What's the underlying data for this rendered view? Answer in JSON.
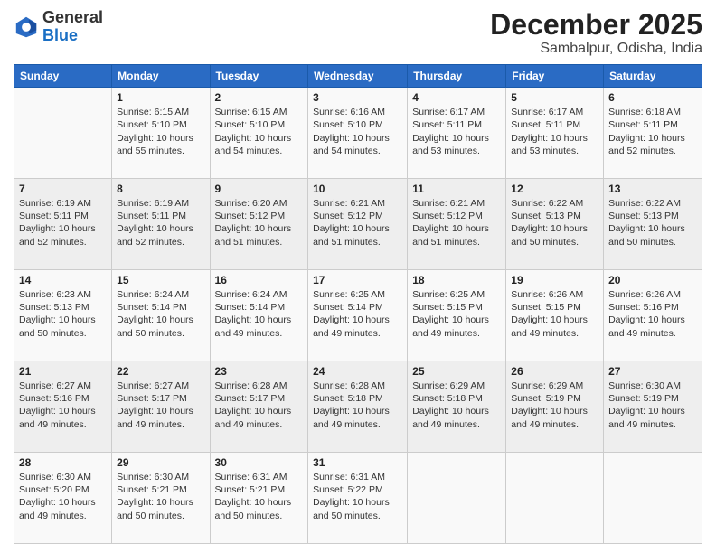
{
  "logo": {
    "general": "General",
    "blue": "Blue"
  },
  "header": {
    "month": "December 2025",
    "location": "Sambalpur, Odisha, India"
  },
  "days_of_week": [
    "Sunday",
    "Monday",
    "Tuesday",
    "Wednesday",
    "Thursday",
    "Friday",
    "Saturday"
  ],
  "weeks": [
    [
      {
        "day": "",
        "info": ""
      },
      {
        "day": "1",
        "info": "Sunrise: 6:15 AM\nSunset: 5:10 PM\nDaylight: 10 hours\nand 55 minutes."
      },
      {
        "day": "2",
        "info": "Sunrise: 6:15 AM\nSunset: 5:10 PM\nDaylight: 10 hours\nand 54 minutes."
      },
      {
        "day": "3",
        "info": "Sunrise: 6:16 AM\nSunset: 5:10 PM\nDaylight: 10 hours\nand 54 minutes."
      },
      {
        "day": "4",
        "info": "Sunrise: 6:17 AM\nSunset: 5:11 PM\nDaylight: 10 hours\nand 53 minutes."
      },
      {
        "day": "5",
        "info": "Sunrise: 6:17 AM\nSunset: 5:11 PM\nDaylight: 10 hours\nand 53 minutes."
      },
      {
        "day": "6",
        "info": "Sunrise: 6:18 AM\nSunset: 5:11 PM\nDaylight: 10 hours\nand 52 minutes."
      }
    ],
    [
      {
        "day": "7",
        "info": "Sunrise: 6:19 AM\nSunset: 5:11 PM\nDaylight: 10 hours\nand 52 minutes."
      },
      {
        "day": "8",
        "info": "Sunrise: 6:19 AM\nSunset: 5:11 PM\nDaylight: 10 hours\nand 52 minutes."
      },
      {
        "day": "9",
        "info": "Sunrise: 6:20 AM\nSunset: 5:12 PM\nDaylight: 10 hours\nand 51 minutes."
      },
      {
        "day": "10",
        "info": "Sunrise: 6:21 AM\nSunset: 5:12 PM\nDaylight: 10 hours\nand 51 minutes."
      },
      {
        "day": "11",
        "info": "Sunrise: 6:21 AM\nSunset: 5:12 PM\nDaylight: 10 hours\nand 51 minutes."
      },
      {
        "day": "12",
        "info": "Sunrise: 6:22 AM\nSunset: 5:13 PM\nDaylight: 10 hours\nand 50 minutes."
      },
      {
        "day": "13",
        "info": "Sunrise: 6:22 AM\nSunset: 5:13 PM\nDaylight: 10 hours\nand 50 minutes."
      }
    ],
    [
      {
        "day": "14",
        "info": "Sunrise: 6:23 AM\nSunset: 5:13 PM\nDaylight: 10 hours\nand 50 minutes."
      },
      {
        "day": "15",
        "info": "Sunrise: 6:24 AM\nSunset: 5:14 PM\nDaylight: 10 hours\nand 50 minutes."
      },
      {
        "day": "16",
        "info": "Sunrise: 6:24 AM\nSunset: 5:14 PM\nDaylight: 10 hours\nand 49 minutes."
      },
      {
        "day": "17",
        "info": "Sunrise: 6:25 AM\nSunset: 5:14 PM\nDaylight: 10 hours\nand 49 minutes."
      },
      {
        "day": "18",
        "info": "Sunrise: 6:25 AM\nSunset: 5:15 PM\nDaylight: 10 hours\nand 49 minutes."
      },
      {
        "day": "19",
        "info": "Sunrise: 6:26 AM\nSunset: 5:15 PM\nDaylight: 10 hours\nand 49 minutes."
      },
      {
        "day": "20",
        "info": "Sunrise: 6:26 AM\nSunset: 5:16 PM\nDaylight: 10 hours\nand 49 minutes."
      }
    ],
    [
      {
        "day": "21",
        "info": "Sunrise: 6:27 AM\nSunset: 5:16 PM\nDaylight: 10 hours\nand 49 minutes."
      },
      {
        "day": "22",
        "info": "Sunrise: 6:27 AM\nSunset: 5:17 PM\nDaylight: 10 hours\nand 49 minutes."
      },
      {
        "day": "23",
        "info": "Sunrise: 6:28 AM\nSunset: 5:17 PM\nDaylight: 10 hours\nand 49 minutes."
      },
      {
        "day": "24",
        "info": "Sunrise: 6:28 AM\nSunset: 5:18 PM\nDaylight: 10 hours\nand 49 minutes."
      },
      {
        "day": "25",
        "info": "Sunrise: 6:29 AM\nSunset: 5:18 PM\nDaylight: 10 hours\nand 49 minutes."
      },
      {
        "day": "26",
        "info": "Sunrise: 6:29 AM\nSunset: 5:19 PM\nDaylight: 10 hours\nand 49 minutes."
      },
      {
        "day": "27",
        "info": "Sunrise: 6:30 AM\nSunset: 5:19 PM\nDaylight: 10 hours\nand 49 minutes."
      }
    ],
    [
      {
        "day": "28",
        "info": "Sunrise: 6:30 AM\nSunset: 5:20 PM\nDaylight: 10 hours\nand 49 minutes."
      },
      {
        "day": "29",
        "info": "Sunrise: 6:30 AM\nSunset: 5:21 PM\nDaylight: 10 hours\nand 50 minutes."
      },
      {
        "day": "30",
        "info": "Sunrise: 6:31 AM\nSunset: 5:21 PM\nDaylight: 10 hours\nand 50 minutes."
      },
      {
        "day": "31",
        "info": "Sunrise: 6:31 AM\nSunset: 5:22 PM\nDaylight: 10 hours\nand 50 minutes."
      },
      {
        "day": "",
        "info": ""
      },
      {
        "day": "",
        "info": ""
      },
      {
        "day": "",
        "info": ""
      }
    ]
  ]
}
